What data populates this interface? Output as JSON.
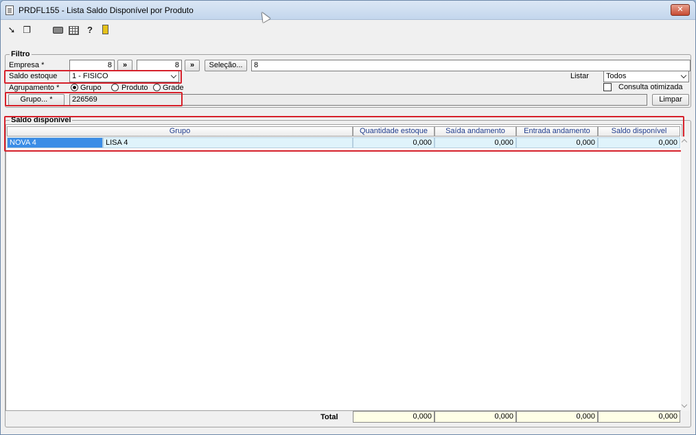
{
  "window": {
    "title": "PRDFL155 - Lista Saldo Disponível por Produto",
    "close_label": "✕"
  },
  "toolbar": {
    "icons": [
      "arrow-icon",
      "copy-icon",
      "print-icon",
      "calendar-grid-icon",
      "help-icon",
      "exit-door-icon"
    ],
    "help_glyph": "?"
  },
  "filtro": {
    "legend": "Filtro",
    "empresa_label": "Empresa *",
    "empresa_from": "8",
    "empresa_to": "8",
    "jump_label": "»",
    "selecao_label": "Seleção...",
    "selecao_value": "8",
    "saldo_estoque_label": "Saldo estoque",
    "saldo_estoque_value": "1 - FISICO",
    "listar_label": "Listar",
    "listar_value": "Todos",
    "consulta_otimizada_label": "Consulta otimizada",
    "agrupamento_label": "Agrupamento *",
    "agrupamento_options": [
      "Grupo",
      "Produto",
      "Grade"
    ],
    "agrupamento_selected": "Grupo",
    "grupo_button_label": "Grupo... *",
    "grupo_value": "226569",
    "limpar_label": "Limpar"
  },
  "saldo": {
    "legend": "Saldo disponível",
    "columns": [
      "Grupo",
      "Quantidade estoque",
      "Saída andamento",
      "Entrada andamento",
      "Saldo disponível"
    ],
    "rows": [
      {
        "grupo_code": "NOVA 4",
        "grupo_name": "LISA 4",
        "quantidade": "0,000",
        "saida": "0,000",
        "entrada": "0,000",
        "saldo": "0,000"
      }
    ],
    "total_label": "Total",
    "totals": [
      "0,000",
      "0,000",
      "0,000",
      "0,000"
    ]
  }
}
